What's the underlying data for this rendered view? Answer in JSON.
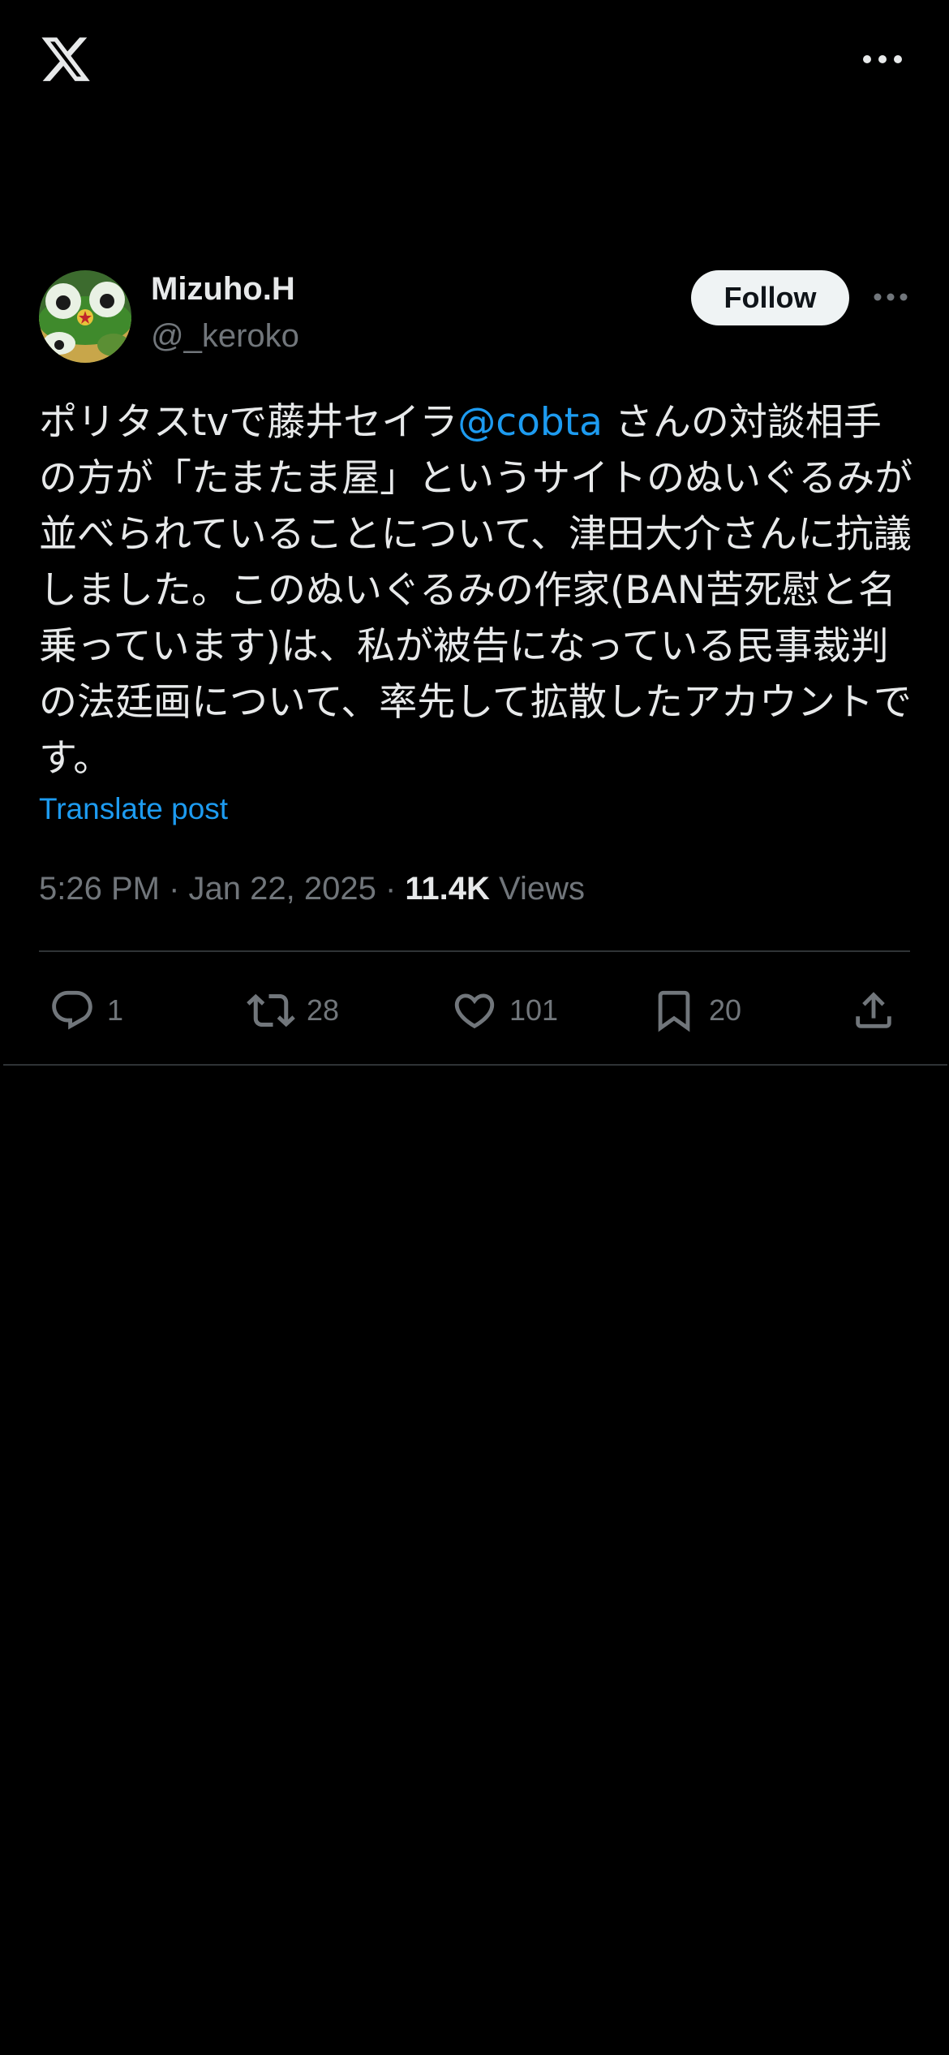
{
  "app": {
    "logo_icon": "x-logo-icon",
    "more_icon": "more-horizontal-icon"
  },
  "post": {
    "author": {
      "display_name": "Mizuho.H",
      "handle": "@_keroko",
      "avatar_icon": "avatar-frog-image"
    },
    "follow_label": "Follow",
    "text_before_mention": "ポリタスtvで藤井セイラ",
    "mention": "@cobta",
    "text_after_mention": " さんの対談相手の方が「たまたま屋」というサイトのぬいぐるみが並べられていることについて、津田大介さんに抗議しました。このぬいぐるみの作家(BAN苦死慰と名乗っています)は、私が被告になっている民事裁判の法廷画について、率先して拡散したアカウントです。",
    "translate_label": "Translate post",
    "time": "5:26 PM",
    "separator": " · ",
    "date": "Jan 22, 2025",
    "views_count": "11.4K",
    "views_label": " Views",
    "actions": {
      "replies": "1",
      "reposts": "28",
      "likes": "101",
      "bookmarks": "20"
    }
  },
  "colors": {
    "background": "#000000",
    "text_primary": "#e7e9ea",
    "text_secondary": "#71767b",
    "accent": "#1d9bf0",
    "divider": "#2f3336",
    "follow_bg": "#eff3f4"
  }
}
